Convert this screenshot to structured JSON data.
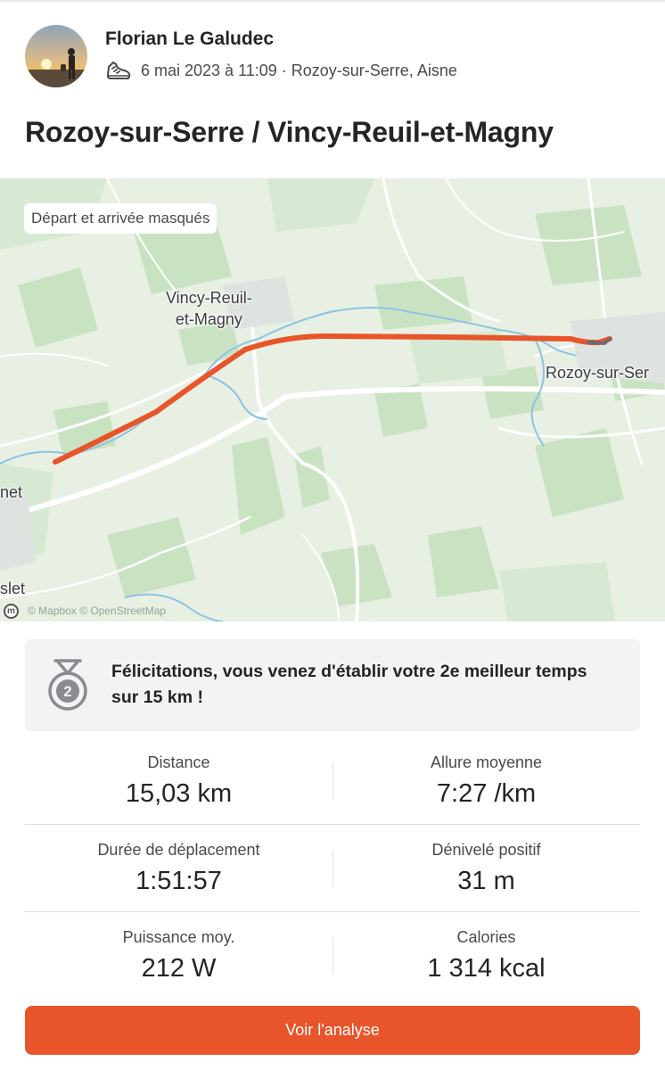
{
  "athlete": {
    "name": "Florian Le Galudec",
    "date": "6 mai 2023 à 11:09",
    "location": "Rozoy-sur-Serre, Aisne",
    "sport_icon": "running-shoe-icon"
  },
  "activity": {
    "title": "Rozoy-sur-Serre / Vincy-Reuil-et-Magny"
  },
  "map": {
    "privacy_label": "Départ et arrivée masqués",
    "labels": {
      "vincy_line1": "Vincy-Reuil-",
      "vincy_line2": "et-Magny",
      "rozoy": "Rozoy-sur-Ser",
      "left_mid": "net",
      "left_bottom": "slet"
    },
    "attribution": "© Mapbox © OpenStreetMap",
    "route_color": "#e8552a"
  },
  "achievement": {
    "icon": "medal-2-icon",
    "text": "Félicitations, vous venez d'établir votre 2e meilleur temps sur 15 km !"
  },
  "stats": {
    "distance": {
      "label": "Distance",
      "value": "15,03 km"
    },
    "pace": {
      "label": "Allure moyenne",
      "value": "7:27 /km"
    },
    "moving_time": {
      "label": "Durée de déplacement",
      "value": "1:51:57"
    },
    "elevation": {
      "label": "Dénivelé positif",
      "value": "31 m"
    },
    "power": {
      "label": "Puissance moy.",
      "value": "212 W"
    },
    "calories": {
      "label": "Calories",
      "value": "1 314 kcal"
    }
  },
  "cta": {
    "label": "Voir l'analyse"
  },
  "colors": {
    "accent": "#e8552a",
    "text": "#242428",
    "muted": "#494950",
    "card": "#f3f3f5"
  }
}
